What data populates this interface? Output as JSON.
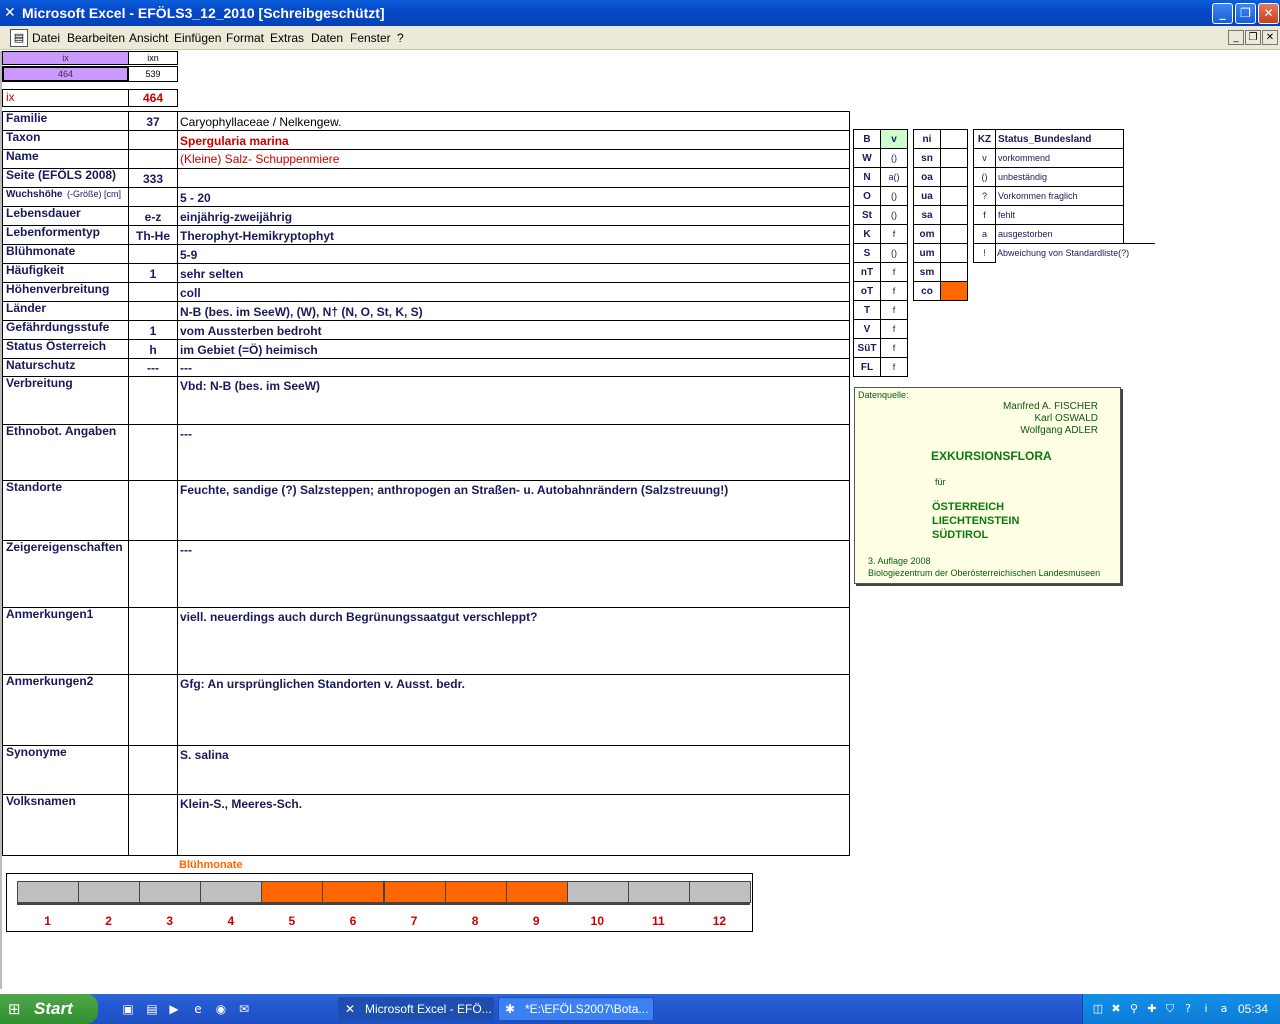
{
  "window": {
    "title": "Microsoft Excel - EFÖLS3_12_2010  [Schreibgeschützt]"
  },
  "menu": [
    "Datei",
    "Bearbeiten",
    "Ansicht",
    "Einfügen",
    "Format",
    "Extras",
    "Daten",
    "Fenster",
    "?"
  ],
  "top": {
    "ix_header": "ix",
    "ixn_header": "ixn",
    "ix_value": "464",
    "ixn_value": "539",
    "ix_label": "ix",
    "ix_red": "464"
  },
  "fields": [
    {
      "label": "Familie",
      "code": "37",
      "value": "Caryophyllaceae  /  Nelkengew."
    },
    {
      "label": "Taxon",
      "code": "",
      "value": "Spergularia marina"
    },
    {
      "label": "Name",
      "code": "",
      "value": "(Kleine) Salz- Schuppenmiere"
    },
    {
      "label": "Seite (EFÖLS 2008)",
      "code": "333",
      "value": ""
    },
    {
      "label": "Wuchshöhe",
      "label_suffix": "(-Größe) [cm]",
      "code": "",
      "value": "5 - 20"
    },
    {
      "label": "Lebensdauer",
      "code": "e-z",
      "value": "einjährig-zweijährig"
    },
    {
      "label": "Lebenformentyp",
      "code": "Th-He",
      "value": "Therophyt-Hemikryptophyt"
    },
    {
      "label": "Blühmonate",
      "code": "",
      "value": "5-9"
    },
    {
      "label": "Häufigkeit",
      "code": "1",
      "value": "sehr selten"
    },
    {
      "label": "Höhenverbreitung",
      "code": "",
      "value": "coll"
    },
    {
      "label": "Länder",
      "code": "",
      "value": "N-B (bes. im SeeW), (W), N† (N, O, St, K, S)"
    },
    {
      "label": "Gefährdungsstufe",
      "code": "1",
      "value": "vom Aussterben bedroht"
    },
    {
      "label": "Status Österreich",
      "code": "h",
      "value": "im Gebiet (=Ö) heimisch"
    },
    {
      "label": "Naturschutz",
      "code": "---",
      "value": "---"
    },
    {
      "label": "Verbreitung",
      "code": "",
      "value": "Vbd: N-B (bes. im SeeW)"
    },
    {
      "label": "Ethnobot. Angaben",
      "code": "",
      "value": "---"
    },
    {
      "label": "Standorte",
      "code": "",
      "value": "Feuchte, sandige (?) Salzsteppen; anthropogen an Straßen- u. Autobahnrändern (Salzstreuung!)"
    },
    {
      "label": "Zeigereigenschaften",
      "code": "",
      "value": "---"
    },
    {
      "label": "Anmerkungen1",
      "code": "",
      "value": "viell. neuerdings auch durch Begrünungssaatgut verschleppt?"
    },
    {
      "label": "Anmerkungen2",
      "code": "",
      "value": "Gfg: An ursprünglichen Standorten v. Ausst. bedr."
    },
    {
      "label": "Synonyme",
      "code": "",
      "value": "S. salina"
    },
    {
      "label": "Volksnamen",
      "code": "",
      "value": "Klein-S., Meeres-Sch."
    }
  ],
  "status_table": {
    "header": [
      "B",
      "v"
    ],
    "rows": [
      [
        "W",
        "()"
      ],
      [
        "N",
        "a()"
      ],
      [
        "O",
        "()"
      ],
      [
        "St",
        "()"
      ],
      [
        "K",
        "f"
      ],
      [
        "S",
        "()"
      ],
      [
        "nT",
        "f"
      ],
      [
        "oT",
        "f"
      ],
      [
        "T",
        "f"
      ],
      [
        "V",
        "f"
      ],
      [
        "SüT",
        "f"
      ],
      [
        "FL",
        "f"
      ]
    ]
  },
  "region_table": {
    "rows": [
      "ni",
      "sn",
      "oa",
      "ua",
      "sa",
      "om",
      "um",
      "sm",
      "co"
    ],
    "highlight": "co",
    "highlight_color": "#ff6600"
  },
  "legend": {
    "kz": "KZ",
    "title": "Status_Bundesland",
    "rows": [
      [
        "v",
        "vorkommend"
      ],
      [
        "()",
        "unbeständig"
      ],
      [
        "?",
        "Vorkommen fraglich"
      ],
      [
        "f",
        "fehlt"
      ],
      [
        "a",
        "ausgestorben"
      ],
      [
        "!",
        "Abweichung von Standardliste(?)"
      ]
    ]
  },
  "source": {
    "label": "Datenquelle:",
    "authors": [
      "Manfred A. FISCHER",
      "Karl OSWALD",
      "Wolfgang ADLER"
    ],
    "title": "EXKURSIONSFLORA",
    "fuer": "für",
    "regions": [
      "ÖSTERREICH",
      "LIECHTENSTEIN",
      "SÜDTIROL"
    ],
    "edition": "3. Auflage 2008",
    "publisher": "Biologiezentrum der Oberösterreichischen Landesmuseen"
  },
  "bloom": {
    "title": "Blühmonate",
    "months": [
      "1",
      "2",
      "3",
      "4",
      "5",
      "6",
      "7",
      "8",
      "9",
      "10",
      "11",
      "12"
    ],
    "active": [
      5,
      6,
      7,
      8,
      9
    ],
    "active_color": "#ff6600",
    "inactive_color": "#c0c0c0"
  },
  "taskbar": {
    "start": "Start",
    "tasks": [
      "Microsoft Excel - EFÖ...",
      "*E:\\EFÖLS2007\\Bota..."
    ],
    "clock": "05:34"
  }
}
